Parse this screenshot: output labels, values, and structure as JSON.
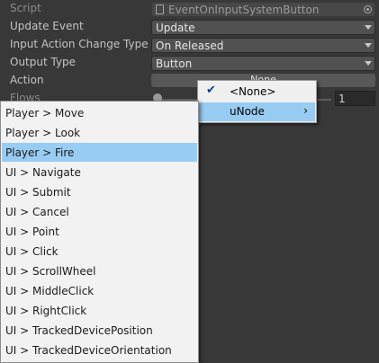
{
  "inspector": {
    "script_label": "Script",
    "script_value": "EventOnInputSystemButton",
    "update_event_label": "Update Event",
    "update_event_value": "Update",
    "input_action_change_type_label": "Input Action Change Type",
    "input_action_change_type_value": "On Released",
    "output_type_label": "Output Type",
    "output_type_value": "Button",
    "action_label": "Action",
    "action_value": "None",
    "flows_label": "Flows",
    "flows_value": "1"
  },
  "context_menu": {
    "items": [
      {
        "label": "<None>",
        "checked": true
      },
      {
        "label": "uNode",
        "submenu": true
      }
    ]
  },
  "action_list": {
    "selected": "Player > Fire",
    "items": [
      "Player > Move",
      "Player > Look",
      "Player > Fire",
      "UI > Navigate",
      "UI > Submit",
      "UI > Cancel",
      "UI > Point",
      "UI > Click",
      "UI > ScrollWheel",
      "UI > MiddleClick",
      "UI > RightClick",
      "UI > TrackedDevicePosition",
      "UI > TrackedDeviceOrientation"
    ]
  }
}
